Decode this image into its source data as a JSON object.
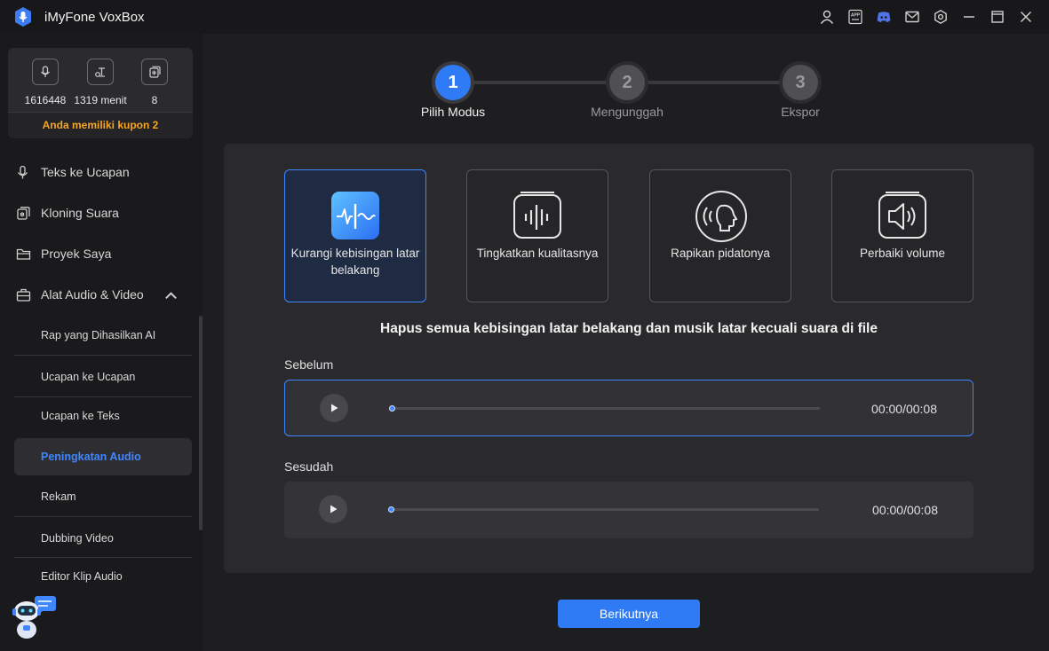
{
  "app": {
    "title": "iMyFone VoxBox"
  },
  "titlebar": {
    "icons": [
      "user-icon",
      "app-icon",
      "discord-icon",
      "mail-icon",
      "settings-icon",
      "minimize-icon",
      "maximize-icon",
      "close-icon"
    ],
    "app_badge": "APP"
  },
  "sidebar": {
    "stats": [
      {
        "icon": "microphone-icon",
        "value": "1616448"
      },
      {
        "icon": "text-to-speech-icon",
        "value": "1319 menit"
      },
      {
        "icon": "voice-clone-icon",
        "value": "8"
      }
    ],
    "coupon": "Anda memiliki kupon 2",
    "nav": [
      {
        "icon": "tts-icon",
        "label": "Teks ke Ucapan"
      },
      {
        "icon": "clone-icon",
        "label": "Kloning Suara"
      },
      {
        "icon": "folder-icon",
        "label": "Proyek Saya"
      },
      {
        "icon": "toolbox-icon",
        "label": "Alat Audio & Video",
        "expanded": true
      }
    ],
    "sub_items": [
      {
        "label": "Rap yang Dihasilkan AI"
      },
      {
        "label": "Ucapan ke Ucapan"
      },
      {
        "label": "Ucapan ke Teks"
      },
      {
        "label": "Peningkatan Audio",
        "active": true
      },
      {
        "label": "Rekam"
      },
      {
        "label": "Dubbing Video"
      },
      {
        "label": "Editor Klip Audio"
      }
    ]
  },
  "steps": [
    {
      "number": "1",
      "label": "Pilih Modus",
      "state": "active"
    },
    {
      "number": "2",
      "label": "Mengunggah",
      "state": "pending"
    },
    {
      "number": "3",
      "label": "Ekspor",
      "state": "pending"
    }
  ],
  "modes": [
    {
      "icon": "noise-reduction-icon",
      "label": "Kurangi kebisingan latar belakang",
      "active": true
    },
    {
      "icon": "quality-enhance-icon",
      "label": "Tingkatkan kualitasnya",
      "active": false
    },
    {
      "icon": "speech-clean-icon",
      "label": "Rapikan pidatonya",
      "active": false
    },
    {
      "icon": "volume-fix-icon",
      "label": "Perbaiki volume",
      "active": false
    }
  ],
  "description": "Hapus semua kebisingan latar belakang dan musik latar kecuali suara di file",
  "players": {
    "before": {
      "label": "Sebelum",
      "time": "00:00/00:08",
      "progress": 0
    },
    "after": {
      "label": "Sesudah",
      "time": "00:00/00:08",
      "progress": 0
    }
  },
  "next_button": "Berikutnya",
  "colors": {
    "accent": "#2f7bf5",
    "coupon": "#f5a623",
    "active_text": "#3f86ff"
  }
}
